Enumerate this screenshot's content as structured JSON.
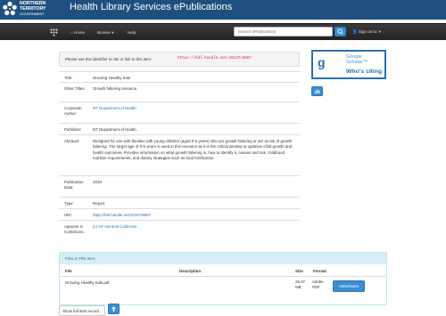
{
  "banner": {
    "logo_lines": [
      "NORTHERN",
      "TERRITORY",
      "GOVERNMENT"
    ],
    "site_title": "Health Library Services ePublications"
  },
  "navbar": {
    "home": "Home",
    "browse": "Browse",
    "help": "Help",
    "search_placeholder": "Search ePublications",
    "signin": "Sign on to:"
  },
  "identifier": {
    "text": "Please use this identifier to cite or link to this item:",
    "url": "https://hdl.handle.net/10137/8687"
  },
  "metadata": [
    {
      "label": "Title:",
      "value": "Growing Healthy Kids",
      "link": false
    },
    {
      "label": "Other Titles:",
      "value": "Growth faltering resource",
      "link": false
    },
    {
      "label": "Corporate Author:",
      "value": "NT Department of Health",
      "link": true
    },
    {
      "label": "Publisher:",
      "value": "NT Department of Health",
      "link": false
    },
    {
      "label": "Abstract:",
      "value": "Designed for use with families with young children (aged 0-5 years) who are growth faltering or are at risk of growth faltering. The target age of 0-5 years is used in this resource as it is the critical window to optimise child growth and health outcomes. Provides information on what growth faltering is, how to identify it, causes and risk, childhood nutrition requirements, and dietary strategies such as food fortification.",
      "link": false
    },
    {
      "label": "Publication Date:",
      "value": "2019",
      "link": false
    },
    {
      "label": "Type:",
      "value": "Report",
      "link": false
    },
    {
      "label": "URI:",
      "value": "https://hdl.handle.net/10137/8687",
      "link": true
    },
    {
      "label": "Appears in Collections:",
      "value": "(c) NT General Collection",
      "link": true
    }
  ],
  "scholar": {
    "line1": "Google",
    "line2": "Scholar™",
    "line3": "Who's citing"
  },
  "files": {
    "heading": "Files in This Item:",
    "columns": [
      "File",
      "Description",
      "Size",
      "Format"
    ],
    "rows": [
      {
        "file": "Growing Healthy Kids.pdf",
        "description": "",
        "size": "25.07 MB",
        "format": "Adobe PDF",
        "action": "View/Open"
      }
    ]
  },
  "footer": {
    "full_record": "Show full item record"
  },
  "colors": {
    "banner": "#1e4f7e",
    "navbar": "#222222",
    "primary_button": "#3a8ed3",
    "link": "#2a6fb0"
  }
}
